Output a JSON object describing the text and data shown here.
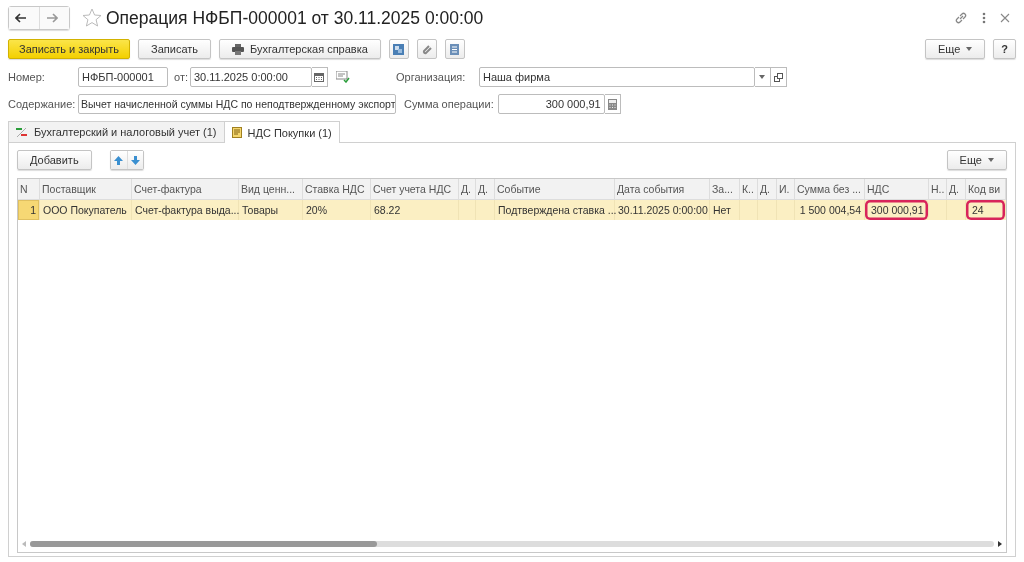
{
  "window": {
    "title": "Операция НФБП-000001 от 30.11.2025 0:00:00",
    "favorite": false
  },
  "toolbar": {
    "buttons": [
      {
        "label": "Записать и закрыть",
        "kind": "primary"
      },
      {
        "label": "Записать",
        "kind": "plain"
      },
      {
        "label": "Бухгалтерская справка",
        "kind": "print"
      }
    ],
    "more": "Еще",
    "help": "?"
  },
  "fields": {
    "number_label": "Номер:",
    "number": "НФБП-000001",
    "date_label": "от:",
    "date": "30.11.2025  0:00:00",
    "org_label": "Организация:",
    "org": "Наша фирма",
    "content_label": "Содержание:",
    "content": "Вычет начисленной суммы НДС по неподтвержденному экспорт",
    "sum_label": "Сумма операции:",
    "sum": "300 000,91"
  },
  "tabs": [
    {
      "label": "Бухгалтерский и налоговый учет (1)",
      "selected": false,
      "kind": "ledger"
    },
    {
      "label": "НДС Покупки (1)",
      "selected": true,
      "kind": "doc"
    }
  ],
  "table_toolbar": {
    "add": "Добавить",
    "more": "Еще"
  },
  "table": {
    "columns": [
      "N",
      "Поставщик",
      "Счет-фактура",
      "Вид ценн...",
      "Ставка НДС",
      "Счет учета НДС",
      "Д.",
      "Д.",
      "Событие",
      "Дата события",
      "За...",
      "К..",
      "Д.",
      "И.",
      "Сумма без ...",
      "НДС",
      "Н..",
      "Д.",
      "Код ви"
    ],
    "rows": [
      {
        "selected": true,
        "cells": [
          {
            "text": "1",
            "highlighted": false
          },
          {
            "text": "ООО Покупатель",
            "highlighted": false
          },
          {
            "text": "Счет-фактура выда...",
            "highlighted": false
          },
          {
            "text": "Товары",
            "highlighted": false
          },
          {
            "text": "20%",
            "highlighted": false
          },
          {
            "text": "68.22",
            "highlighted": false
          },
          {
            "text": "",
            "highlighted": false
          },
          {
            "text": "",
            "highlighted": false
          },
          {
            "text": "Подтверждена ставка ...",
            "highlighted": false
          },
          {
            "text": "30.11.2025 0:00:00",
            "highlighted": false
          },
          {
            "text": "Нет",
            "highlighted": false
          },
          {
            "text": "",
            "highlighted": false
          },
          {
            "text": "",
            "highlighted": false
          },
          {
            "text": "",
            "highlighted": false
          },
          {
            "text": "1 500 004,54",
            "highlighted": false
          },
          {
            "text": "300 000,91",
            "highlighted": true
          },
          {
            "text": "",
            "highlighted": false
          },
          {
            "text": "",
            "highlighted": false
          },
          {
            "text": "24",
            "highlighted": true
          }
        ]
      }
    ]
  }
}
